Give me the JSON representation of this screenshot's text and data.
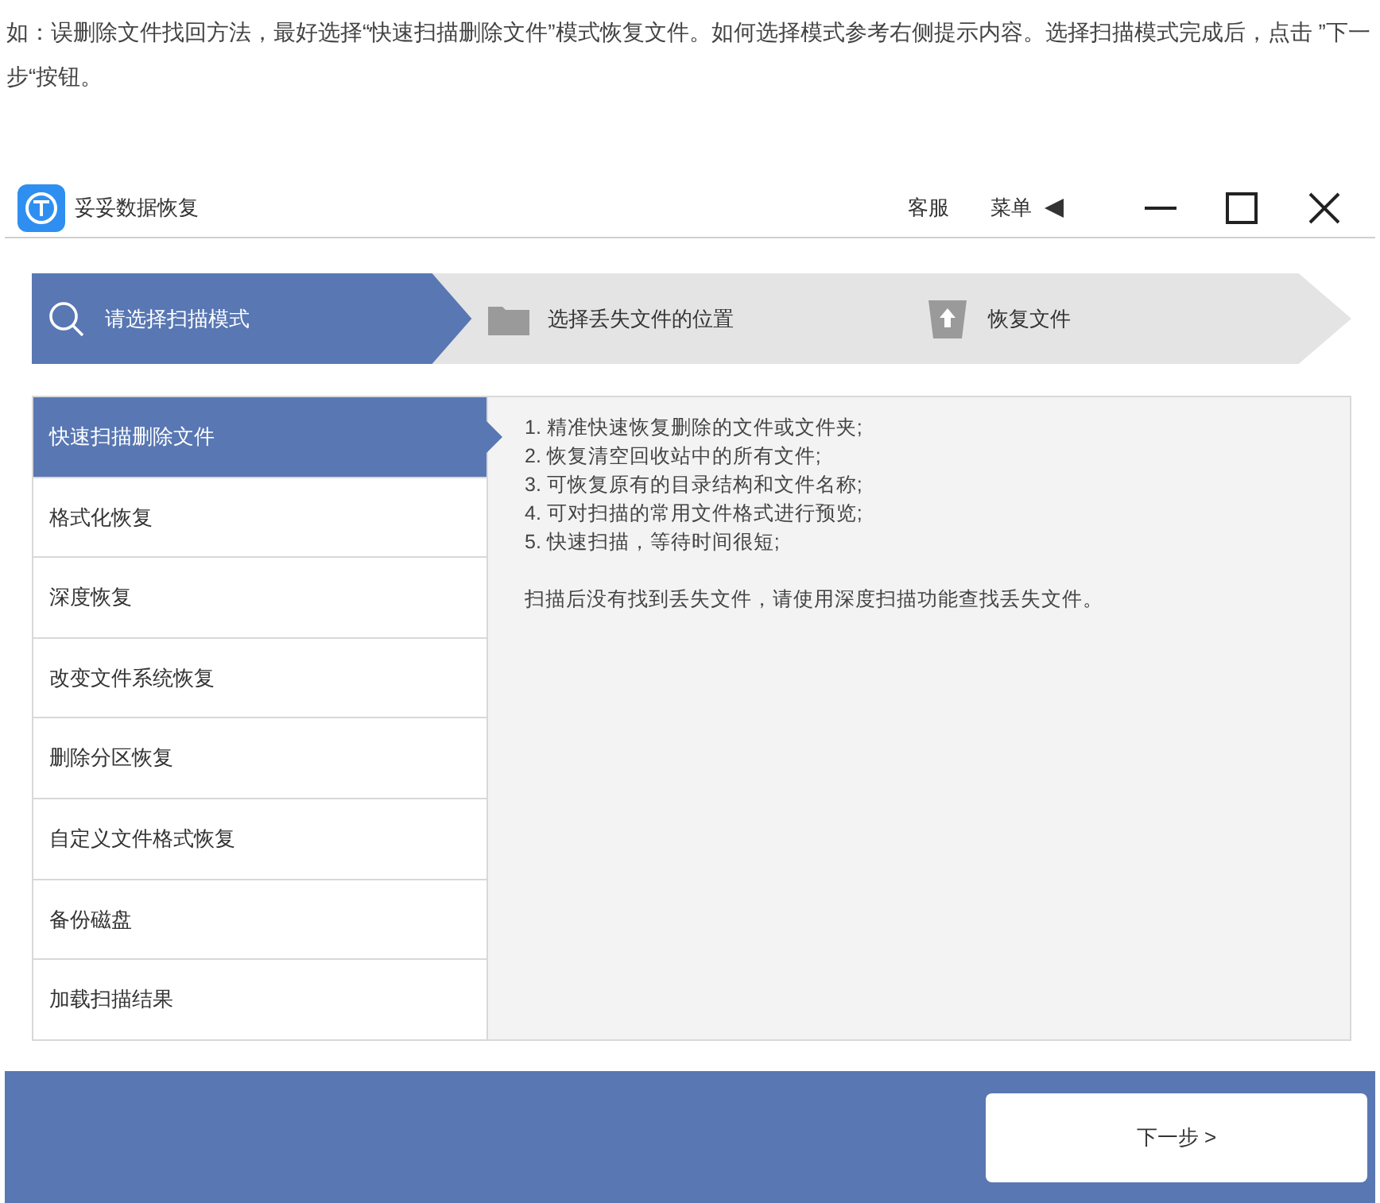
{
  "intro": "如：误删除文件找回方法，最好选择“快速扫描删除文件”模式恢复文件。如何选择模式参考右侧提示内容。选择扫描模式完成后，点击 ”下一步“按钮。",
  "app": {
    "title": "妥妥数据恢复",
    "header_links": [
      "客服",
      "菜单"
    ],
    "steps": [
      {
        "label": "请选择扫描模式",
        "selected": true
      },
      {
        "label": "选择丢失文件的位置",
        "selected": false
      },
      {
        "label": "恢复文件",
        "selected": false
      }
    ],
    "modes": [
      {
        "label": "快速扫描删除文件",
        "selected": true
      },
      {
        "label": "格式化恢复",
        "selected": false
      },
      {
        "label": "深度恢复",
        "selected": false
      },
      {
        "label": "改变文件系统恢复",
        "selected": false
      },
      {
        "label": "删除分区恢复",
        "selected": false
      },
      {
        "label": "自定义文件格式恢复",
        "selected": false
      },
      {
        "label": "备份磁盘",
        "selected": false
      },
      {
        "label": "加载扫描结果",
        "selected": false
      }
    ],
    "features": [
      "1. 精准快速恢复删除的文件或文件夹;",
      "2. 恢复清空回收站中的所有文件;",
      "3. 可恢复原有的目录结构和文件名称;",
      "4. 可对扫描的常用文件格式进行预览;",
      "5. 快速扫描，等待时间很短;"
    ],
    "note": "扫描后没有找到丢失文件，请使用深度扫描功能查找丢失文件。",
    "next_button": "下一步 >"
  }
}
